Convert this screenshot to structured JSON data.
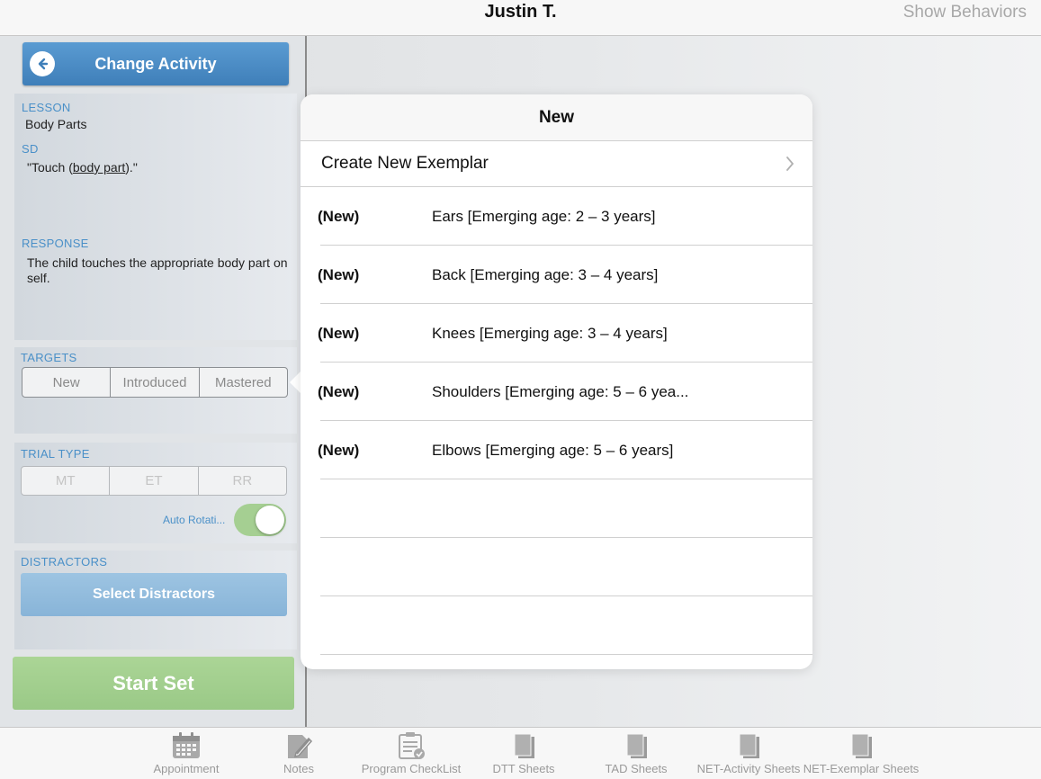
{
  "nav": {
    "title": "Justin T.",
    "right_button": "Show Behaviors"
  },
  "sidebar": {
    "change_activity": "Change Activity",
    "lesson_label": "LESSON",
    "lesson_value": "Body Parts",
    "sd_label": "SD",
    "sd_prefix": "\"Touch (",
    "sd_link": "body part",
    "sd_suffix": ").\"",
    "response_label": "RESPONSE",
    "response_value": "The child touches the appropriate body part on self.",
    "targets_label": "TARGETS",
    "targets_options": [
      "New",
      "Introduced",
      "Mastered"
    ],
    "trial_type_label": "TRIAL TYPE",
    "trial_type_options": [
      "MT",
      "ET",
      "RR"
    ],
    "auto_rotation_label": "Auto Rotati...",
    "auto_rotation_on": true,
    "distractors_label": "DISTRACTORS",
    "select_distractors": "Select Distractors",
    "start_set": "Start Set"
  },
  "popover": {
    "title": "New",
    "create_label": "Create New Exemplar",
    "exemplars": [
      {
        "status": "(New)",
        "label": "Ears [Emerging age:  2 – 3 years]"
      },
      {
        "status": "(New)",
        "label": "Back [Emerging age:  3 – 4 years]"
      },
      {
        "status": "(New)",
        "label": "Knees [Emerging age:  3 – 4 years]"
      },
      {
        "status": "(New)",
        "label": "Shoulders [Emerging age:  5 – 6 yea..."
      },
      {
        "status": "(New)",
        "label": "Elbows [Emerging age:  5 – 6 years]"
      }
    ]
  },
  "tabs": [
    {
      "label": "Appointment",
      "icon": "calendar-icon"
    },
    {
      "label": "Notes",
      "icon": "notes-icon"
    },
    {
      "label": "Program CheckList",
      "icon": "checklist-icon"
    },
    {
      "label": "DTT Sheets",
      "icon": "sheets-icon"
    },
    {
      "label": "TAD Sheets",
      "icon": "sheets-icon"
    },
    {
      "label": "NET-Activity Sheets",
      "icon": "sheets-icon"
    },
    {
      "label": "NET-Exemplar Sheets",
      "icon": "sheets-icon"
    }
  ],
  "colors": {
    "accent_blue": "#4a90c8",
    "start_green": "#9ac987",
    "toggle_green": "#a5cf92"
  }
}
